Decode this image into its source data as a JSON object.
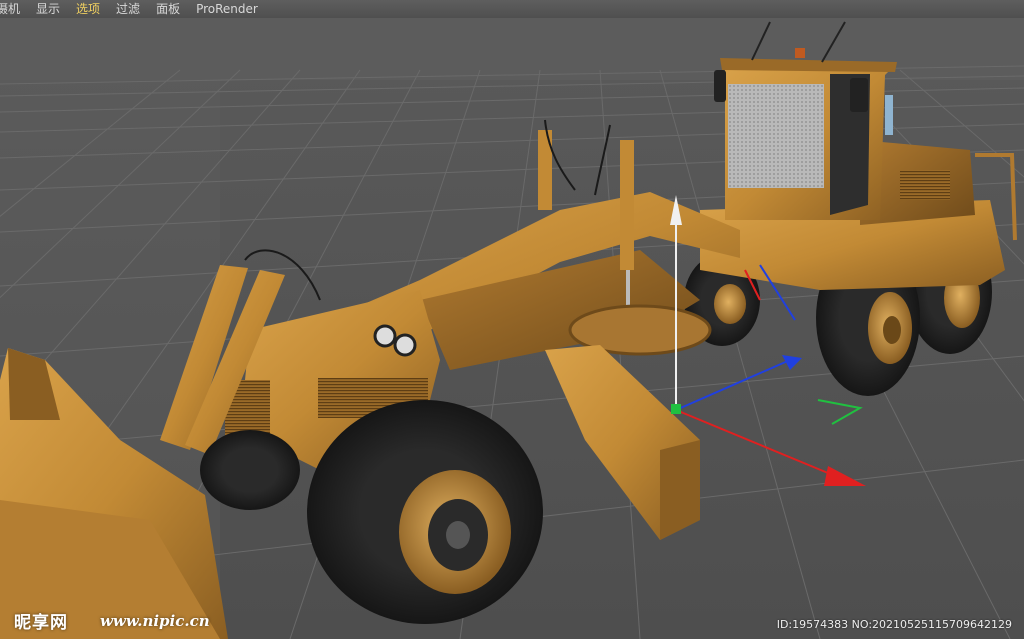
{
  "menubar": {
    "items": [
      {
        "label": "摄机",
        "active": false
      },
      {
        "label": "显示",
        "active": false
      },
      {
        "label": "选项",
        "active": true
      },
      {
        "label": "过滤",
        "active": false
      },
      {
        "label": "面板",
        "active": false
      },
      {
        "label": "ProRender",
        "active": false
      }
    ]
  },
  "viewport": {
    "model": "motor-grader",
    "axis_colors": {
      "x": "#e02020",
      "y": "#f0f0f0",
      "z": "#2040e0",
      "world_x": "#d02020",
      "world_y": "#20c040",
      "world_z": "#2040e0"
    }
  },
  "watermark": {
    "logo": "昵享网",
    "site": "www.nipic.cn",
    "id_text": "ID:19574383 NO:20210525115709642129"
  }
}
